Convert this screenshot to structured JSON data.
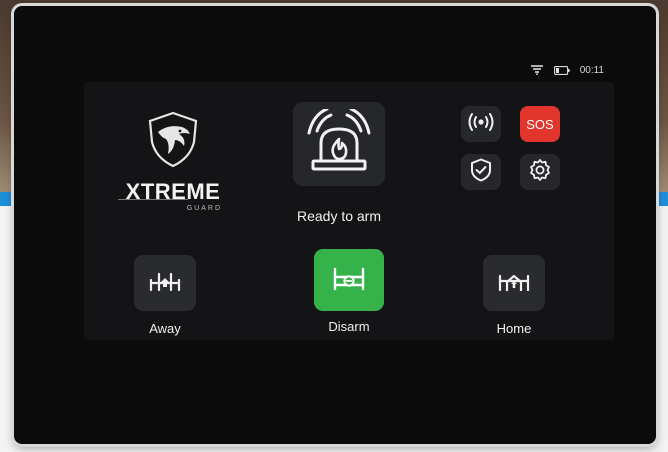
{
  "status_bar": {
    "wifi_icon": "wifi-icon",
    "battery_icon": "battery-icon",
    "time": "00:11"
  },
  "logo": {
    "word": "XTREME",
    "sub": "GUARD"
  },
  "alarm": {
    "icon": "siren-icon",
    "status": "Ready to arm"
  },
  "quick_actions": [
    {
      "icon": "broadcast-icon"
    },
    {
      "label": "SOS",
      "color": "#e2352b"
    },
    {
      "icon": "shield-check-icon"
    },
    {
      "icon": "gear-icon"
    }
  ],
  "modes": [
    {
      "label": "Away",
      "icon": "away-house-icon",
      "active": false
    },
    {
      "label": "Disarm",
      "icon": "disarm-house-icon",
      "active": true,
      "color": "#36b24a"
    },
    {
      "label": "Home",
      "icon": "home-house-icon",
      "active": false
    }
  ]
}
